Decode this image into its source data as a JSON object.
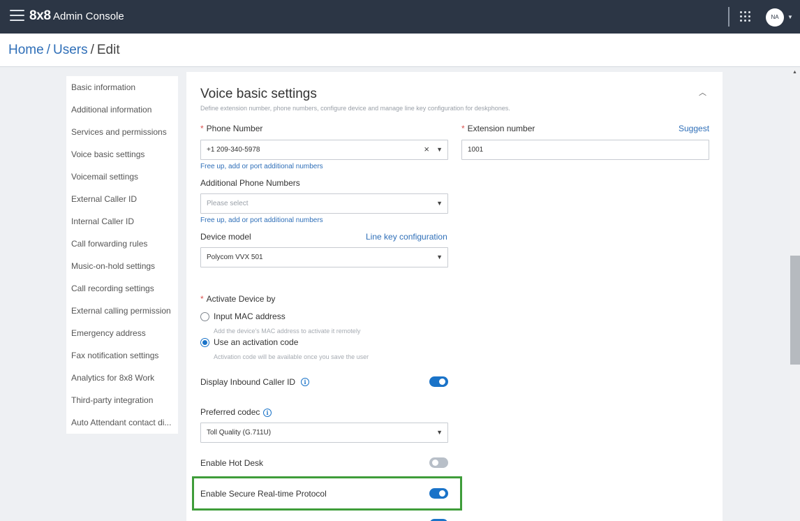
{
  "app": {
    "brand": "8x8",
    "title": "Admin Console",
    "avatar_initials": "NA"
  },
  "breadcrumb": {
    "home": "Home",
    "separator": "/",
    "users": "Users",
    "current": "Edit"
  },
  "sidebar": {
    "items": [
      "Basic information",
      "Additional information",
      "Services and permissions",
      "Voice basic settings",
      "Voicemail settings",
      "External Caller ID",
      "Internal Caller ID",
      "Call forwarding rules",
      "Music-on-hold settings",
      "Call recording settings",
      "External calling permission",
      "Emergency address",
      "Fax notification settings",
      "Analytics for 8x8 Work",
      "Third-party integration",
      "Auto Attendant contact di..."
    ]
  },
  "section": {
    "title": "Voice basic settings",
    "description": "Define extension number, phone numbers, configure device and manage line key configuration for deskphones."
  },
  "form": {
    "phone_number": {
      "label": "Phone Number",
      "value": "+1 209-340-5978",
      "link": "Free up, add or port additional numbers"
    },
    "extension": {
      "label": "Extension number",
      "suggest": "Suggest",
      "value": "1001"
    },
    "additional_numbers": {
      "label": "Additional Phone Numbers",
      "placeholder": "Please select",
      "link": "Free up, add or port additional numbers"
    },
    "device_model": {
      "label": "Device model",
      "link": "Line key configuration",
      "value": "Polycom VVX 501"
    },
    "activate": {
      "label": "Activate Device by",
      "option_mac": "Input MAC address",
      "option_mac_hint": "Add the device's MAC address to activate it remotely",
      "option_code": "Use an activation code",
      "option_code_hint": "Activation code will be available once you save the user",
      "selected": "Use an activation code"
    },
    "inbound_caller_id": {
      "label": "Display Inbound Caller ID",
      "enabled": true
    },
    "codec": {
      "label": "Preferred codec",
      "value": "Toll Quality (G.711U)"
    },
    "hot_desk": {
      "label": "Enable Hot Desk",
      "enabled": false
    },
    "srtp": {
      "label": "Enable Secure Real-time Protocol",
      "enabled": true
    }
  },
  "colors": {
    "topbar": "#2c3645",
    "accent": "#1a73c8",
    "highlight": "#3f9d3a",
    "link": "#2f6fb8"
  },
  "icons": {
    "menu": "hamburger-icon",
    "apps": "grid-icon",
    "collapse": "chevron-up-icon",
    "info": "info-icon"
  }
}
